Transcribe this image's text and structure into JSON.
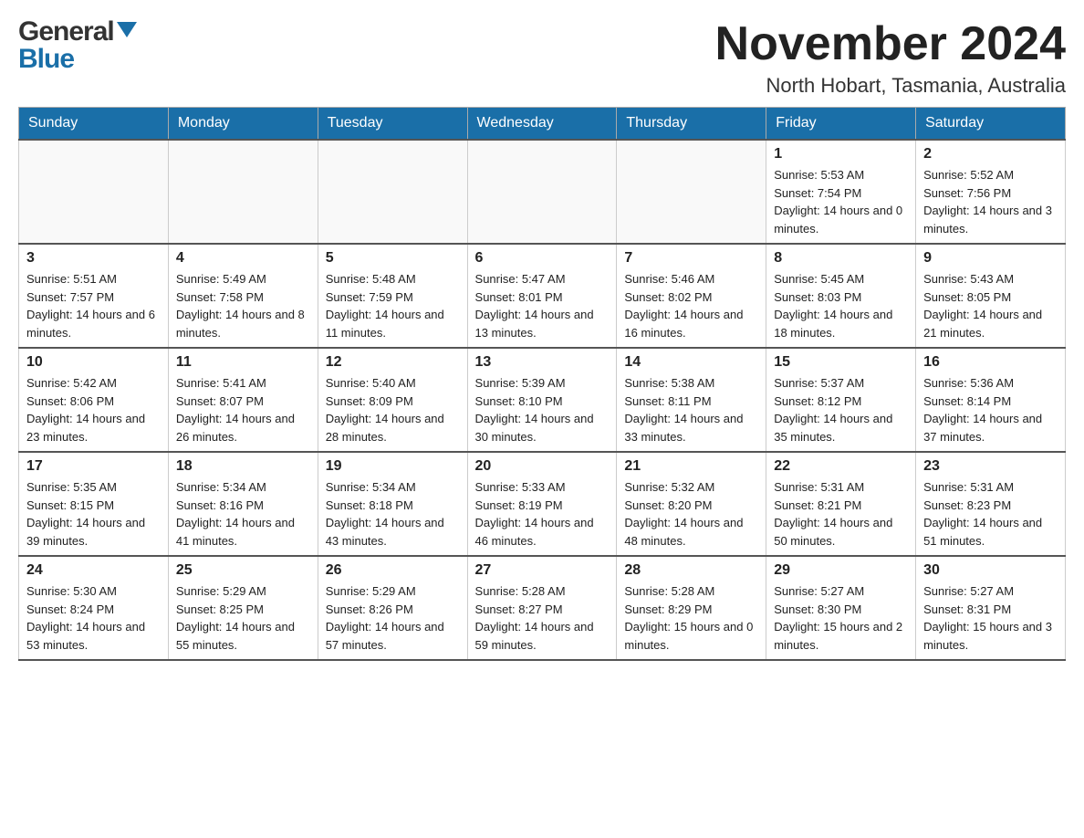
{
  "header": {
    "logo_line1": "General",
    "logo_line2": "Blue",
    "month_title": "November 2024",
    "location": "North Hobart, Tasmania, Australia"
  },
  "weekdays": [
    "Sunday",
    "Monday",
    "Tuesday",
    "Wednesday",
    "Thursday",
    "Friday",
    "Saturday"
  ],
  "weeks": [
    [
      {
        "day": "",
        "info": ""
      },
      {
        "day": "",
        "info": ""
      },
      {
        "day": "",
        "info": ""
      },
      {
        "day": "",
        "info": ""
      },
      {
        "day": "",
        "info": ""
      },
      {
        "day": "1",
        "info": "Sunrise: 5:53 AM\nSunset: 7:54 PM\nDaylight: 14 hours and 0 minutes."
      },
      {
        "day": "2",
        "info": "Sunrise: 5:52 AM\nSunset: 7:56 PM\nDaylight: 14 hours and 3 minutes."
      }
    ],
    [
      {
        "day": "3",
        "info": "Sunrise: 5:51 AM\nSunset: 7:57 PM\nDaylight: 14 hours and 6 minutes."
      },
      {
        "day": "4",
        "info": "Sunrise: 5:49 AM\nSunset: 7:58 PM\nDaylight: 14 hours and 8 minutes."
      },
      {
        "day": "5",
        "info": "Sunrise: 5:48 AM\nSunset: 7:59 PM\nDaylight: 14 hours and 11 minutes."
      },
      {
        "day": "6",
        "info": "Sunrise: 5:47 AM\nSunset: 8:01 PM\nDaylight: 14 hours and 13 minutes."
      },
      {
        "day": "7",
        "info": "Sunrise: 5:46 AM\nSunset: 8:02 PM\nDaylight: 14 hours and 16 minutes."
      },
      {
        "day": "8",
        "info": "Sunrise: 5:45 AM\nSunset: 8:03 PM\nDaylight: 14 hours and 18 minutes."
      },
      {
        "day": "9",
        "info": "Sunrise: 5:43 AM\nSunset: 8:05 PM\nDaylight: 14 hours and 21 minutes."
      }
    ],
    [
      {
        "day": "10",
        "info": "Sunrise: 5:42 AM\nSunset: 8:06 PM\nDaylight: 14 hours and 23 minutes."
      },
      {
        "day": "11",
        "info": "Sunrise: 5:41 AM\nSunset: 8:07 PM\nDaylight: 14 hours and 26 minutes."
      },
      {
        "day": "12",
        "info": "Sunrise: 5:40 AM\nSunset: 8:09 PM\nDaylight: 14 hours and 28 minutes."
      },
      {
        "day": "13",
        "info": "Sunrise: 5:39 AM\nSunset: 8:10 PM\nDaylight: 14 hours and 30 minutes."
      },
      {
        "day": "14",
        "info": "Sunrise: 5:38 AM\nSunset: 8:11 PM\nDaylight: 14 hours and 33 minutes."
      },
      {
        "day": "15",
        "info": "Sunrise: 5:37 AM\nSunset: 8:12 PM\nDaylight: 14 hours and 35 minutes."
      },
      {
        "day": "16",
        "info": "Sunrise: 5:36 AM\nSunset: 8:14 PM\nDaylight: 14 hours and 37 minutes."
      }
    ],
    [
      {
        "day": "17",
        "info": "Sunrise: 5:35 AM\nSunset: 8:15 PM\nDaylight: 14 hours and 39 minutes."
      },
      {
        "day": "18",
        "info": "Sunrise: 5:34 AM\nSunset: 8:16 PM\nDaylight: 14 hours and 41 minutes."
      },
      {
        "day": "19",
        "info": "Sunrise: 5:34 AM\nSunset: 8:18 PM\nDaylight: 14 hours and 43 minutes."
      },
      {
        "day": "20",
        "info": "Sunrise: 5:33 AM\nSunset: 8:19 PM\nDaylight: 14 hours and 46 minutes."
      },
      {
        "day": "21",
        "info": "Sunrise: 5:32 AM\nSunset: 8:20 PM\nDaylight: 14 hours and 48 minutes."
      },
      {
        "day": "22",
        "info": "Sunrise: 5:31 AM\nSunset: 8:21 PM\nDaylight: 14 hours and 50 minutes."
      },
      {
        "day": "23",
        "info": "Sunrise: 5:31 AM\nSunset: 8:23 PM\nDaylight: 14 hours and 51 minutes."
      }
    ],
    [
      {
        "day": "24",
        "info": "Sunrise: 5:30 AM\nSunset: 8:24 PM\nDaylight: 14 hours and 53 minutes."
      },
      {
        "day": "25",
        "info": "Sunrise: 5:29 AM\nSunset: 8:25 PM\nDaylight: 14 hours and 55 minutes."
      },
      {
        "day": "26",
        "info": "Sunrise: 5:29 AM\nSunset: 8:26 PM\nDaylight: 14 hours and 57 minutes."
      },
      {
        "day": "27",
        "info": "Sunrise: 5:28 AM\nSunset: 8:27 PM\nDaylight: 14 hours and 59 minutes."
      },
      {
        "day": "28",
        "info": "Sunrise: 5:28 AM\nSunset: 8:29 PM\nDaylight: 15 hours and 0 minutes."
      },
      {
        "day": "29",
        "info": "Sunrise: 5:27 AM\nSunset: 8:30 PM\nDaylight: 15 hours and 2 minutes."
      },
      {
        "day": "30",
        "info": "Sunrise: 5:27 AM\nSunset: 8:31 PM\nDaylight: 15 hours and 3 minutes."
      }
    ]
  ]
}
